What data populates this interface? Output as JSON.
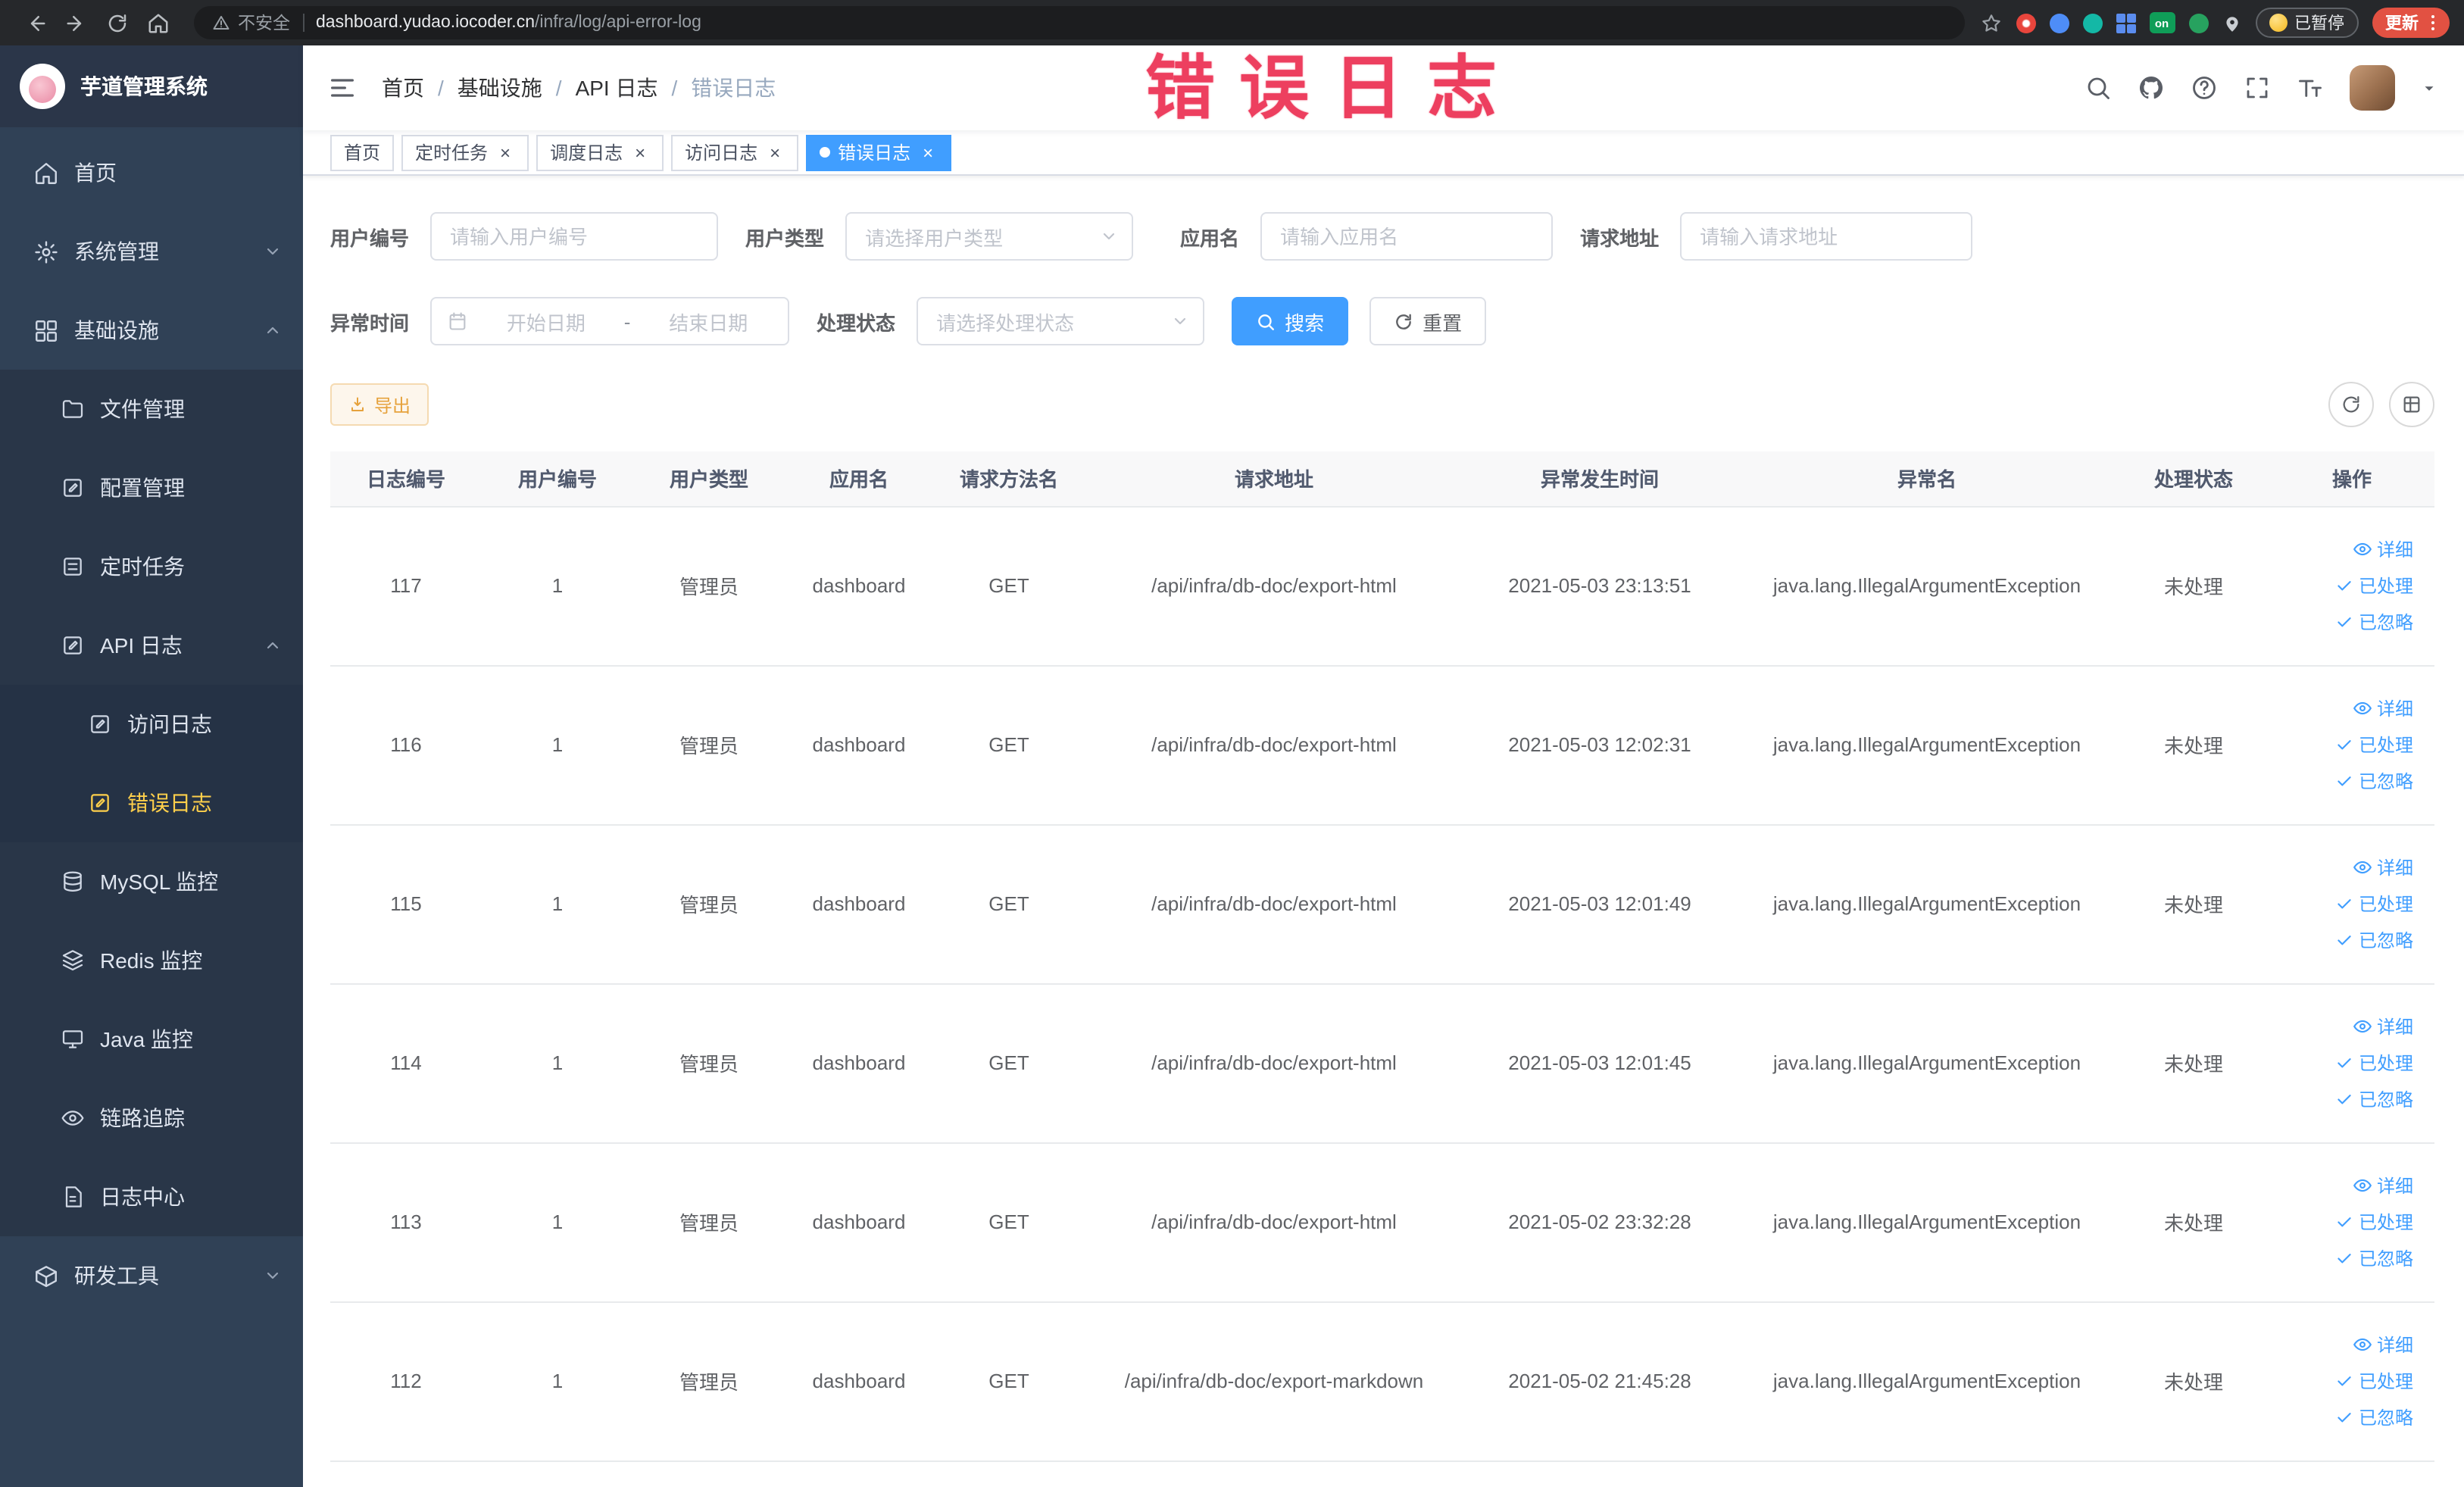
{
  "colors": {
    "accent": "#409eff",
    "sidebar_active": "#ffd04b",
    "watermark": "#ed3f5f",
    "warning_text": "#e6a23c",
    "link": "#409eff",
    "update_button_bg": "#e25142"
  },
  "browser": {
    "security_label": "不安全",
    "url_domain": "dashboard.yudao.iocoder.cn",
    "url_path": "/infra/log/api-error-log",
    "extension_on_badge": "on",
    "paused_badge": "已暂停",
    "update_button": "更新"
  },
  "watermark": "错误日志",
  "ui": {
    "close_glyph": "×"
  },
  "sidebar": {
    "logo_title": "芋道管理系统",
    "menu": [
      {
        "label": "首页"
      },
      {
        "label": "系统管理"
      },
      {
        "label": "基础设施"
      },
      {
        "label": "文件管理"
      },
      {
        "label": "配置管理"
      },
      {
        "label": "定时任务"
      },
      {
        "label": "API 日志"
      },
      {
        "label": "访问日志"
      },
      {
        "label": "错误日志"
      },
      {
        "label": "MySQL 监控"
      },
      {
        "label": "Redis 监控"
      },
      {
        "label": "Java 监控"
      },
      {
        "label": "链路追踪"
      },
      {
        "label": "日志中心"
      },
      {
        "label": "研发工具"
      }
    ]
  },
  "header": {
    "breadcrumb": [
      {
        "label": "首页"
      },
      {
        "label": "基础设施"
      },
      {
        "label": "API 日志"
      },
      {
        "label": "错误日志"
      }
    ],
    "breadcrumb_separator": "/"
  },
  "tabs": [
    {
      "label": "首页",
      "closable": false,
      "active": false
    },
    {
      "label": "定时任务",
      "closable": true,
      "active": false
    },
    {
      "label": "调度日志",
      "closable": true,
      "active": false
    },
    {
      "label": "访问日志",
      "closable": true,
      "active": false
    },
    {
      "label": "错误日志",
      "closable": true,
      "active": true
    }
  ],
  "filters": {
    "user_id_label": "用户编号",
    "user_id_placeholder": "请输入用户编号",
    "user_type_label": "用户类型",
    "user_type_placeholder": "请选择用户类型",
    "app_name_label": "应用名",
    "app_name_placeholder": "请输入应用名",
    "request_url_label": "请求地址",
    "request_url_placeholder": "请输入请求地址",
    "exception_time_label": "异常时间",
    "start_date_placeholder": "开始日期",
    "date_separator": "-",
    "end_date_placeholder": "结束日期",
    "process_status_label": "处理状态",
    "process_status_placeholder": "请选择处理状态",
    "search_button": "搜索",
    "reset_button": "重置"
  },
  "toolbar": {
    "export_button": "导出"
  },
  "table": {
    "columns": [
      "日志编号",
      "用户编号",
      "用户类型",
      "应用名",
      "请求方法名",
      "请求地址",
      "异常发生时间",
      "异常名",
      "处理状态",
      "操作"
    ],
    "actions": [
      "详细",
      "已处理",
      "已忽略"
    ],
    "rows": [
      {
        "id": "117",
        "user_id": "1",
        "user_type": "管理员",
        "app": "dashboard",
        "method": "GET",
        "url": "/api/infra/db-doc/export-html",
        "time": "2021-05-03 23:13:51",
        "exception": "java.lang.IllegalArgumentException",
        "status": "未处理"
      },
      {
        "id": "116",
        "user_id": "1",
        "user_type": "管理员",
        "app": "dashboard",
        "method": "GET",
        "url": "/api/infra/db-doc/export-html",
        "time": "2021-05-03 12:02:31",
        "exception": "java.lang.IllegalArgumentException",
        "status": "未处理"
      },
      {
        "id": "115",
        "user_id": "1",
        "user_type": "管理员",
        "app": "dashboard",
        "method": "GET",
        "url": "/api/infra/db-doc/export-html",
        "time": "2021-05-03 12:01:49",
        "exception": "java.lang.IllegalArgumentException",
        "status": "未处理"
      },
      {
        "id": "114",
        "user_id": "1",
        "user_type": "管理员",
        "app": "dashboard",
        "method": "GET",
        "url": "/api/infra/db-doc/export-html",
        "time": "2021-05-03 12:01:45",
        "exception": "java.lang.IllegalArgumentException",
        "status": "未处理"
      },
      {
        "id": "113",
        "user_id": "1",
        "user_type": "管理员",
        "app": "dashboard",
        "method": "GET",
        "url": "/api/infra/db-doc/export-html",
        "time": "2021-05-02 23:32:28",
        "exception": "java.lang.IllegalArgumentException",
        "status": "未处理"
      },
      {
        "id": "112",
        "user_id": "1",
        "user_type": "管理员",
        "app": "dashboard",
        "method": "GET",
        "url": "/api/infra/db-doc/export-markdown",
        "time": "2021-05-02 21:45:28",
        "exception": "java.lang.IllegalArgumentException",
        "status": "未处理"
      }
    ]
  }
}
